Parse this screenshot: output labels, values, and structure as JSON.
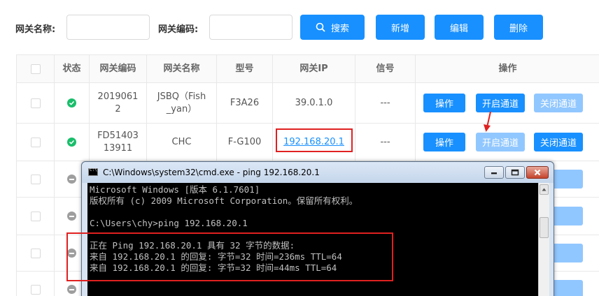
{
  "filters": {
    "gateway_name_label": "网关名称:",
    "gateway_name_value": "",
    "gateway_code_label": "网关编码:",
    "gateway_code_value": ""
  },
  "toolbar": {
    "search_label": "搜索",
    "add_label": "新增",
    "edit_label": "编辑",
    "delete_label": "删除"
  },
  "table": {
    "headers": [
      "状态",
      "网关编码",
      "网关名称",
      "型号",
      "网关IP",
      "信号",
      "操作"
    ],
    "rows": [
      {
        "status": "online",
        "code": "20190612",
        "name": "JSBQ（Fish_yan）",
        "model": "F3A26",
        "ip": "39.0.1.0",
        "signal": "---",
        "op_label": "操作",
        "open_label": "开启通道",
        "close_label": "关闭通道"
      },
      {
        "status": "online",
        "code": "FD5140313911",
        "name": "CHC",
        "model": "F-G100",
        "ip": "192.168.20.1",
        "signal": "---",
        "op_label": "操作",
        "open_label": "开启通道",
        "close_label": "关闭通道"
      },
      {
        "status": "offline"
      },
      {
        "status": "offline"
      },
      {
        "status": "offline"
      },
      {
        "status": "offline"
      }
    ],
    "row1_code_lines": [
      "2019061",
      "2"
    ],
    "row1_name_lines": [
      "JSBQ（Fish",
      "_yan）"
    ],
    "row2_code_lines": [
      "FD51403",
      "13911"
    ]
  },
  "cmd": {
    "title": "C:\\Windows\\system32\\cmd.exe - ping  192.168.20.1",
    "lines": [
      "Microsoft Windows [版本 6.1.7601]",
      "版权所有 (c) 2009 Microsoft Corporation。保留所有权利。",
      "",
      "C:\\Users\\chy>ping 192.168.20.1",
      "",
      "正在 Ping 192.168.20.1 具有 32 字节的数据:",
      "来自 192.168.20.1 的回复: 字节=32 时间=236ms TTL=64",
      "来自 192.168.20.1 的回复: 字节=32 时间=44ms TTL=64"
    ]
  },
  "colors": {
    "primary": "#1890ff",
    "disabled": "#91c7ff",
    "online": "#19be6b",
    "offline": "#9e9e9e",
    "highlight": "#e02020"
  }
}
